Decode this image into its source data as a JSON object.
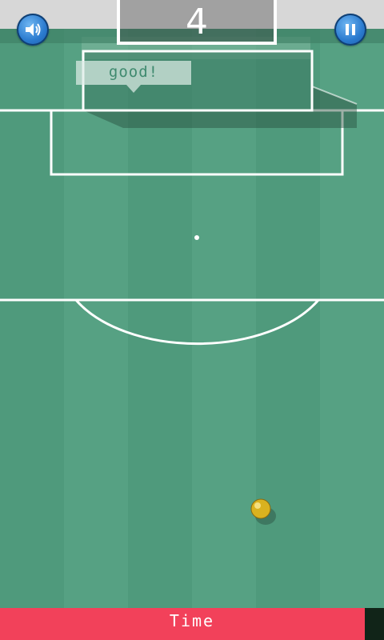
{
  "hud": {
    "score": "4",
    "sound_icon": "speaker-icon",
    "pause_icon": "pause-icon"
  },
  "feedback": {
    "message": "good!"
  },
  "timer": {
    "label": "Time",
    "remaining_fraction": 0.95
  },
  "colors": {
    "pitch_light": "#56a183",
    "pitch_dark": "#4f9a7c",
    "line": "#ffffff",
    "time_bar": "#f2415a",
    "button_blue": "#2b7bcf",
    "ball": "#d9b21f"
  }
}
